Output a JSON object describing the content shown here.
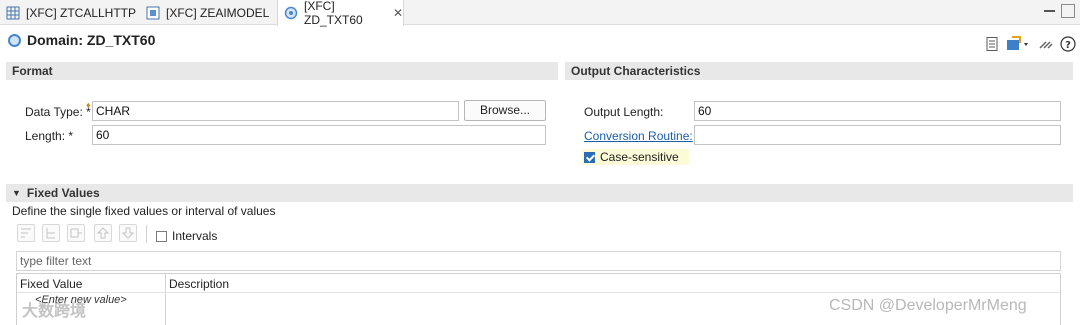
{
  "tabs": [
    {
      "label": "[XFC] ZTCALLHTTP",
      "icon": "table-icon",
      "active": false
    },
    {
      "label": "[XFC] ZEAIMODEL",
      "icon": "structure-icon",
      "active": false
    },
    {
      "label": "[XFC] ZD_TXT60",
      "icon": "domain-icon",
      "active": true
    }
  ],
  "editor": {
    "title": "Domain: ZD_TXT60"
  },
  "format": {
    "header": "Format",
    "data_type_label": "Data Type: *",
    "data_type_value": "CHAR",
    "browse_label": "Browse...",
    "length_label": "Length: *",
    "length_value": "60"
  },
  "output": {
    "header": "Output Characteristics",
    "output_length_label": "Output Length:",
    "output_length_value": "60",
    "conversion_routine_label": "Conversion Routine:",
    "conversion_routine_value": "",
    "case_sensitive_label": "Case-sensitive",
    "case_sensitive_checked": true
  },
  "fixed_values": {
    "header": "Fixed Values",
    "description": "Define the single fixed values or interval of values",
    "intervals_label": "Intervals",
    "filter_placeholder": "type filter text",
    "columns": [
      "Fixed Value",
      "Description"
    ],
    "new_row_placeholder": "<Enter new value>"
  },
  "watermarks": {
    "right": "CSDN @DeveloperMrMeng",
    "left": "大数跨境"
  },
  "colors": {
    "accent": "#2a6db5",
    "link": "#1a5ea8",
    "section_bg": "#e8e8e8",
    "highlight_bg": "#fbfbd8"
  }
}
